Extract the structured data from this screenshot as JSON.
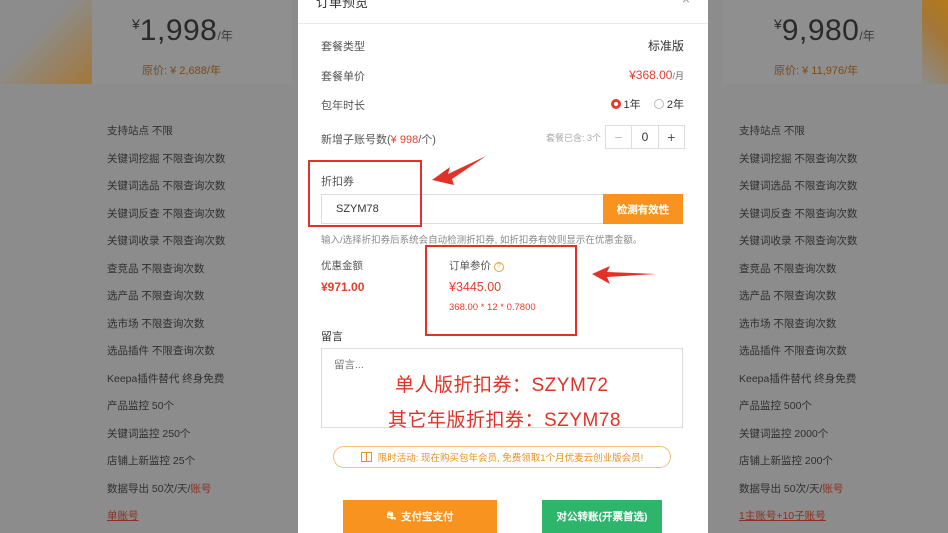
{
  "left_card": {
    "yen": "¥",
    "price": "1,998",
    "unit": "/年",
    "original": "原价: ¥ 2,688/年",
    "features": [
      "支持站点 不限",
      "关键词挖掘 不限查询次数",
      "关键词选品 不限查询次数",
      "关键词反查 不限查询次数",
      "关键词收录 不限查询次数",
      "查竞品 不限查询次数",
      "选产品 不限查询次数",
      "选市场 不限查询次数",
      "选品插件 不限查询次数",
      "Keepa插件替代 终身免费",
      "产品监控 50个",
      "关键词监控 250个",
      "店铺上新监控 25个"
    ],
    "export_prefix": "数据导出 50次/天/",
    "export_suffix": "账号",
    "account": "单账号"
  },
  "right_card": {
    "yen": "¥",
    "price": "9,980",
    "unit": "/年",
    "original": "原价: ¥ 11,976/年",
    "features": [
      "支持站点 不限",
      "关键词挖掘 不限查询次数",
      "关键词选品 不限查询次数",
      "关键词反查 不限查询次数",
      "关键词收录 不限查询次数",
      "查竞品 不限查询次数",
      "选产品 不限查询次数",
      "选市场 不限查询次数",
      "选品插件 不限查询次数",
      "Keepa插件替代 终身免费",
      "产品监控 500个",
      "关键词监控 2000个",
      "店铺上新监控 200个"
    ],
    "export_prefix": "数据导出 50次/天/",
    "export_suffix": "账号",
    "account": "1主账号+10子账号"
  },
  "modal": {
    "title": "订单预览",
    "close": "×",
    "package_type_label": "套餐类型",
    "package_type_value": "标准版",
    "unit_price_label": "套餐单价",
    "unit_price_value": "¥368.00",
    "unit_price_unit": "/月",
    "duration_label": "包年时长",
    "duration_options": [
      "1年",
      "2年"
    ],
    "sub_accounts_label": "新增子账号数(",
    "sub_accounts_price": "¥ 998",
    "sub_accounts_suffix": "/个)",
    "used_note": "套餐已含: 3个",
    "stepper_minus": "−",
    "stepper_value": "0",
    "stepper_plus": "+",
    "coupon_label": "折扣券",
    "coupon_value": "SZYM78",
    "check_button": "检测有效性",
    "hint": "输入/选择折扣券后系统会自动检测折扣券, 如折扣券有效则显示在优惠金额。",
    "discount_label": "优惠金额",
    "discount_value": "¥971.00",
    "reference_label": "订单参价",
    "reference_value": "¥3445.00",
    "formula": "368.00 * 12 * 0.7800",
    "message_label": "留言",
    "message_placeholder": "留言...",
    "overlay_line1": "单人版折扣券：SZYM72",
    "overlay_line2": "其它年版折扣券：SZYM78",
    "promo": "限时活动: 现在购买包年会员, 免费领取1个月优麦云创业版会员!",
    "alipay_button": "支付宝支付",
    "bank_button": "对公转账(开票首选)"
  },
  "colors": {
    "accent_orange": "#f7931e",
    "price_red": "#e53e2c",
    "annotation_red": "#e23228",
    "green": "#2cb56b"
  }
}
